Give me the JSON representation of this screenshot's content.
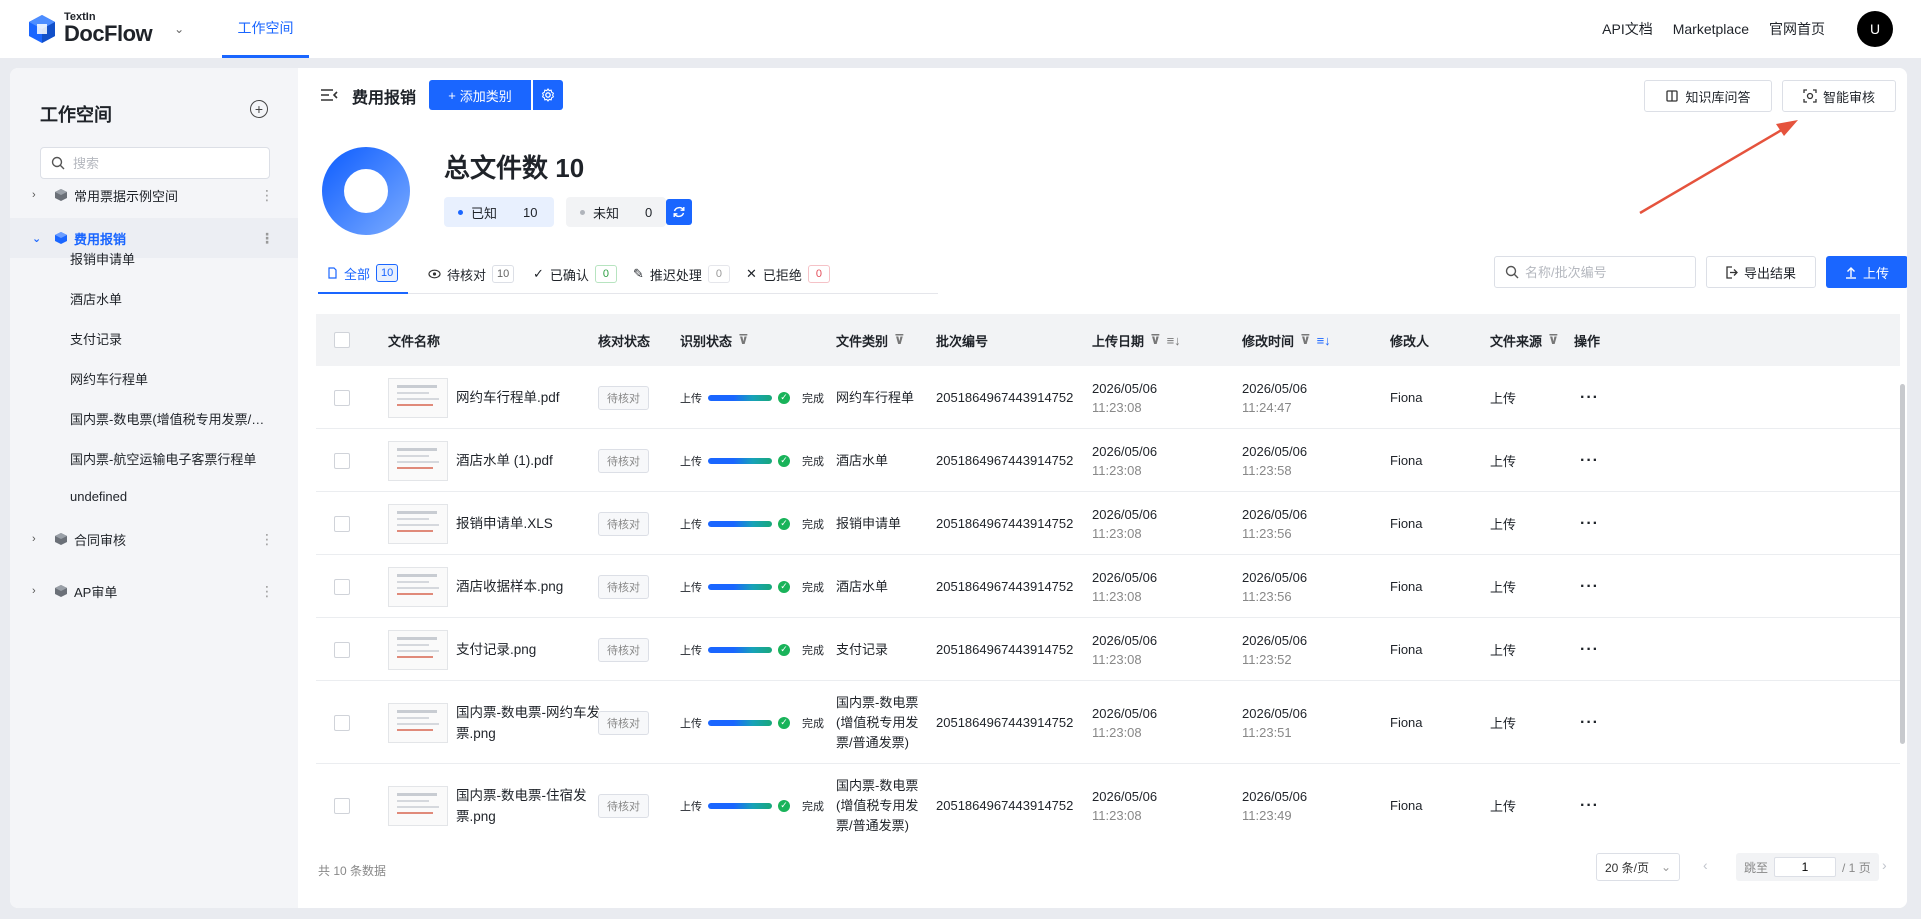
{
  "topnav": {
    "logo_small": "TextIn",
    "logo_big": "DocFlow",
    "active_tab": "工作空间",
    "links": [
      "API文档",
      "Marketplace",
      "官网首页"
    ],
    "avatar": "U"
  },
  "sidebar": {
    "title": "工作空间",
    "search_placeholder": "搜索",
    "groups": [
      {
        "label": "常用票据示例空间"
      },
      {
        "label": "费用报销"
      },
      {
        "label": "合同审核"
      },
      {
        "label": "AP审单"
      }
    ],
    "sub_items": [
      "报销申请单",
      "酒店水单",
      "支付记录",
      "网约车行程单",
      "国内票-数电票(增值税专用发票/普通发票)",
      "国内票-航空运输电子客票行程单",
      "undefined"
    ]
  },
  "header": {
    "title": "费用报销",
    "add_label": "添加类别",
    "kb_label": "知识库问答",
    "audit_label": "智能审核"
  },
  "summary": {
    "total_label": "总文件数",
    "total": "10",
    "known_label": "已知",
    "known": "10",
    "unknown_label": "未知",
    "unknown": "0"
  },
  "tabs": [
    {
      "label": "全部",
      "count": "10"
    },
    {
      "label": "待核对",
      "count": "10"
    },
    {
      "label": "已确认",
      "count": "0"
    },
    {
      "label": "推迟处理",
      "count": "0"
    },
    {
      "label": "已拒绝",
      "count": "0"
    }
  ],
  "toolbar": {
    "search_placeholder": "名称/批次编号",
    "export_label": "导出结果",
    "upload_label": "上传"
  },
  "table": {
    "columns": [
      "文件名称",
      "核对状态",
      "识别状态",
      "文件类别",
      "批次编号",
      "上传日期",
      "修改时间",
      "修改人",
      "文件来源",
      "操作"
    ],
    "rows": [
      {
        "name": "网约车行程单.pdf",
        "status": "待核对",
        "recog_start": "上传",
        "recog_end": "完成",
        "type": "网约车行程单",
        "batch": "2051864967443914752",
        "up_date": "2026/05/06",
        "up_time": "11:23:08",
        "mod_date": "2026/05/06",
        "mod_time": "11:24:47",
        "editor": "Fiona",
        "source": "上传"
      },
      {
        "name": "酒店水单 (1).pdf",
        "status": "待核对",
        "recog_start": "上传",
        "recog_end": "完成",
        "type": "酒店水单",
        "batch": "2051864967443914752",
        "up_date": "2026/05/06",
        "up_time": "11:23:08",
        "mod_date": "2026/05/06",
        "mod_time": "11:23:58",
        "editor": "Fiona",
        "source": "上传"
      },
      {
        "name": "报销申请单.XLS",
        "status": "待核对",
        "recog_start": "上传",
        "recog_end": "完成",
        "type": "报销申请单",
        "batch": "2051864967443914752",
        "up_date": "2026/05/06",
        "up_time": "11:23:08",
        "mod_date": "2026/05/06",
        "mod_time": "11:23:56",
        "editor": "Fiona",
        "source": "上传"
      },
      {
        "name": "酒店收据样本.png",
        "status": "待核对",
        "recog_start": "上传",
        "recog_end": "完成",
        "type": "酒店水单",
        "batch": "2051864967443914752",
        "up_date": "2026/05/06",
        "up_time": "11:23:08",
        "mod_date": "2026/05/06",
        "mod_time": "11:23:56",
        "editor": "Fiona",
        "source": "上传"
      },
      {
        "name": "支付记录.png",
        "status": "待核对",
        "recog_start": "上传",
        "recog_end": "完成",
        "type": "支付记录",
        "batch": "2051864967443914752",
        "up_date": "2026/05/06",
        "up_time": "11:23:08",
        "mod_date": "2026/05/06",
        "mod_time": "11:23:52",
        "editor": "Fiona",
        "source": "上传"
      },
      {
        "name": "国内票-数电票-网约车发票.png",
        "status": "待核对",
        "recog_start": "上传",
        "recog_end": "完成",
        "type": "国内票-数电票(增值税专用发票/普通发票)",
        "batch": "2051864967443914752",
        "up_date": "2026/05/06",
        "up_time": "11:23:08",
        "mod_date": "2026/05/06",
        "mod_time": "11:23:51",
        "editor": "Fiona",
        "source": "上传"
      },
      {
        "name": "国内票-数电票-住宿发票.png",
        "status": "待核对",
        "recog_start": "上传",
        "recog_end": "完成",
        "type": "国内票-数电票(增值税专用发票/普通发票)",
        "batch": "2051864967443914752",
        "up_date": "2026/05/06",
        "up_time": "11:23:08",
        "mod_date": "2026/05/06",
        "mod_time": "11:23:49",
        "editor": "Fiona",
        "source": "上传"
      }
    ],
    "row_action": "···"
  },
  "footer": {
    "total_text": "共 10 条数据",
    "page_size": "20 条/页",
    "jump_label": "跳至",
    "page_value": "1",
    "page_total": "/ 1 页"
  },
  "colors": {
    "accent": "#1a66ff",
    "annotation_arrow": "#e5533d"
  }
}
